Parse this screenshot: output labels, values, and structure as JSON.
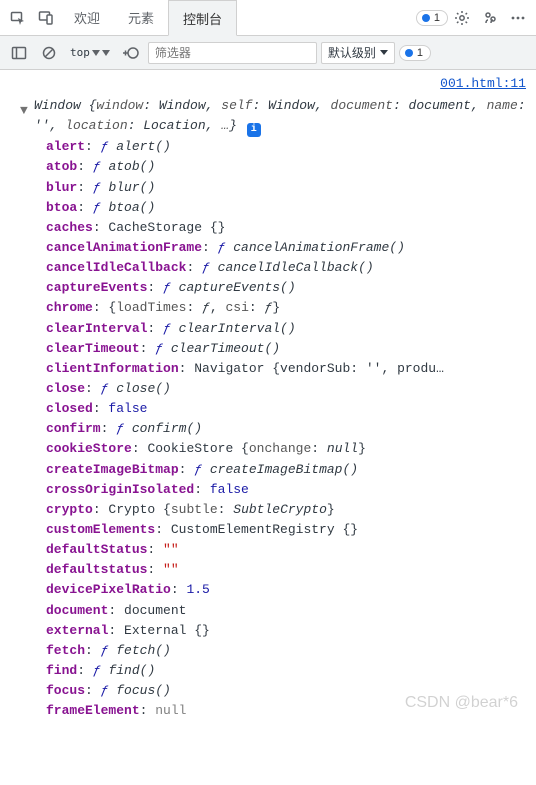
{
  "tabbar": {
    "tabs": [
      {
        "label": "欢迎",
        "active": false
      },
      {
        "label": "元素",
        "active": false
      },
      {
        "label": "控制台",
        "active": true
      }
    ],
    "issue_badge": "1"
  },
  "toolbar": {
    "context_label": "top",
    "filter_placeholder": "筛选器",
    "level_label": "默认级别",
    "issue_badge": "1"
  },
  "source_link": "001.html:11",
  "object_header": {
    "constructor_name": "Window",
    "preview_pairs": [
      {
        "k": "window",
        "v": "Window"
      },
      {
        "k": "self",
        "v": "Window"
      },
      {
        "k": "document",
        "v": "document"
      },
      {
        "k": "name",
        "v": "''"
      },
      {
        "k": "location",
        "v": "Location"
      }
    ],
    "ellipsis": "…"
  },
  "properties": [
    {
      "expandable": true,
      "key": "alert",
      "type": "func",
      "func_name": "alert()"
    },
    {
      "expandable": true,
      "key": "atob",
      "type": "func",
      "func_name": "atob()"
    },
    {
      "expandable": true,
      "key": "blur",
      "type": "func",
      "func_name": "blur()"
    },
    {
      "expandable": true,
      "key": "btoa",
      "type": "func",
      "func_name": "btoa()"
    },
    {
      "expandable": true,
      "key": "caches",
      "type": "preview",
      "preview": "CacheStorage {}"
    },
    {
      "expandable": true,
      "key": "cancelAnimationFrame",
      "type": "func",
      "func_name": "cancelAnimationFrame()"
    },
    {
      "expandable": true,
      "key": "cancelIdleCallback",
      "type": "func",
      "func_name": "cancelIdleCallback()"
    },
    {
      "expandable": true,
      "key": "captureEvents",
      "type": "func",
      "func_name": "captureEvents()"
    },
    {
      "expandable": true,
      "key": "chrome",
      "type": "kvobj",
      "preview_prefix": "{",
      "kv": [
        {
          "k": "loadTimes",
          "v": "ƒ"
        },
        {
          "k": "csi",
          "v": "ƒ"
        }
      ],
      "preview_suffix": "}"
    },
    {
      "expandable": true,
      "key": "clearInterval",
      "type": "func",
      "func_name": "clearInterval()"
    },
    {
      "expandable": true,
      "key": "clearTimeout",
      "type": "func",
      "func_name": "clearTimeout()"
    },
    {
      "expandable": true,
      "key": "clientInformation",
      "type": "preview_trunc",
      "preview": "Navigator {vendorSub: '', produ…"
    },
    {
      "expandable": true,
      "key": "close",
      "type": "func",
      "func_name": "close()"
    },
    {
      "expandable": false,
      "key": "closed",
      "type": "bool",
      "value": "false"
    },
    {
      "expandable": true,
      "key": "confirm",
      "type": "func",
      "func_name": "confirm()"
    },
    {
      "expandable": true,
      "key": "cookieStore",
      "type": "kvobj",
      "preview_prefix": "CookieStore {",
      "kv": [
        {
          "k": "onchange",
          "v": "null"
        }
      ],
      "preview_suffix": "}"
    },
    {
      "expandable": true,
      "key": "createImageBitmap",
      "type": "func",
      "func_name": "createImageBitmap()"
    },
    {
      "expandable": false,
      "key": "crossOriginIsolated",
      "type": "bool",
      "value": "false"
    },
    {
      "expandable": true,
      "key": "crypto",
      "type": "kvobj",
      "preview_prefix": "Crypto {",
      "kv": [
        {
          "k": "subtle",
          "v": "SubtleCrypto"
        }
      ],
      "preview_suffix": "}"
    },
    {
      "expandable": true,
      "key": "customElements",
      "type": "preview",
      "preview": "CustomElementRegistry {}"
    },
    {
      "expandable": false,
      "key": "defaultStatus",
      "type": "string",
      "value": "\"\""
    },
    {
      "expandable": false,
      "key": "defaultstatus",
      "type": "string",
      "value": "\"\""
    },
    {
      "expandable": false,
      "key": "devicePixelRatio",
      "type": "number",
      "value": "1.5"
    },
    {
      "expandable": true,
      "key": "document",
      "type": "preview",
      "preview": "document"
    },
    {
      "expandable": true,
      "key": "external",
      "type": "preview",
      "preview": "External {}"
    },
    {
      "expandable": true,
      "key": "fetch",
      "type": "func",
      "func_name": "fetch()"
    },
    {
      "expandable": true,
      "key": "find",
      "type": "func",
      "func_name": "find()"
    },
    {
      "expandable": true,
      "key": "focus",
      "type": "func",
      "func_name": "focus()"
    },
    {
      "expandable": false,
      "key": "frameElement",
      "type": "null",
      "value": "null"
    }
  ],
  "watermark": "CSDN @bear*6"
}
